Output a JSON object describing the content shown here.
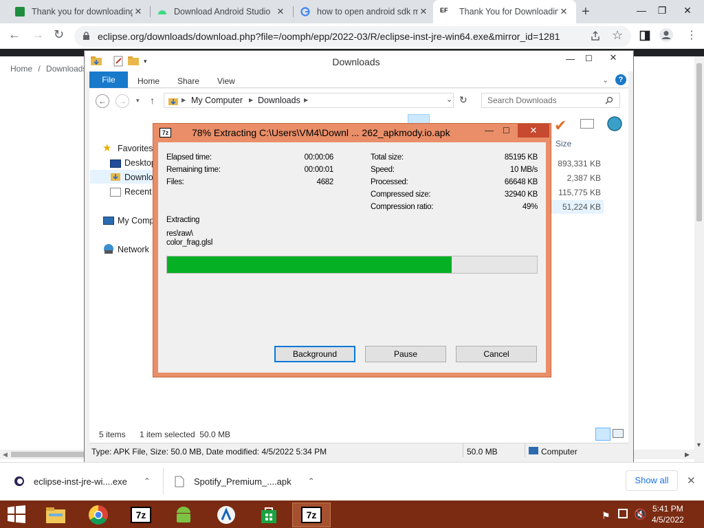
{
  "browser": {
    "tabs": [
      {
        "title": "Thank you for downloading",
        "icon": "sheets-icon",
        "color": "#1e8e3e"
      },
      {
        "title": "Download Android Studio",
        "icon": "android-icon",
        "color": "#3ddc84"
      },
      {
        "title": "how to open android sdk m",
        "icon": "google-icon",
        "color": "#4285f4"
      },
      {
        "title": "Thank You for Downloading",
        "icon": "ef-icon",
        "color": "#1a1a1a",
        "fav_text": "EF"
      }
    ],
    "url": "eclipse.org/downloads/download.php?file=/oomph/epp/2022-03/R/eclipse-inst-jre-win64.exe&mirror_id=1281"
  },
  "page": {
    "breadcrumb": [
      "Home",
      "Downloads"
    ],
    "breadcrumb_sep": "/"
  },
  "explorer": {
    "title": "Downloads",
    "ribbon_tabs": [
      "File",
      "Home",
      "Share",
      "View"
    ],
    "path": [
      "My Computer",
      "Downloads"
    ],
    "search_placeholder": "Search Downloads",
    "nav": {
      "favorites": "Favorites",
      "desktop": "Desktop",
      "downloads": "Downlo",
      "recent": "Recent p",
      "my_computer": "My Comp",
      "network": "Network"
    },
    "column_size": "Size",
    "sizes": [
      "893,331 KB",
      "2,387 KB",
      "115,775 KB",
      "51,224 KB"
    ],
    "status": {
      "items": "5 items",
      "selected": "1 item selected  50.0 MB"
    },
    "details": {
      "text": "Type: APK File, Size: 50.0 MB, Date modified: 4/5/2022 5:34 PM",
      "size": "50.0 MB",
      "location": "Computer"
    }
  },
  "dialog": {
    "title": "78% Extracting C:\\Users\\VM4\\Downl ... 262_apkmody.io.apk",
    "progress": 0.77,
    "left_stats": [
      {
        "label": "Elapsed time:",
        "value": "00:00:06"
      },
      {
        "label": "Remaining time:",
        "value": "00:00:01"
      },
      {
        "label": "Files:",
        "value": "4682"
      }
    ],
    "right_stats": [
      {
        "label": "Total size:",
        "value": "85195 KB"
      },
      {
        "label": "Speed:",
        "value": "10 MB/s"
      },
      {
        "label": "Processed:",
        "value": "66648 KB"
      },
      {
        "label": "Compressed size:",
        "value": "32940 KB"
      },
      {
        "label": "Compression ratio:",
        "value": "49%"
      }
    ],
    "action": "Extracting",
    "path_line1": "res\\raw\\",
    "path_line2": "color_frag.glsl",
    "buttons": {
      "background": "Background",
      "pause": "Pause",
      "cancel": "Cancel"
    }
  },
  "shelf": {
    "items": [
      "eclipse-inst-jre-wi....exe",
      "Spotify_Premium_....apk"
    ],
    "show_all": "Show all"
  },
  "taskbar": {
    "time": "5:41 PM",
    "date": "4/5/2022"
  }
}
